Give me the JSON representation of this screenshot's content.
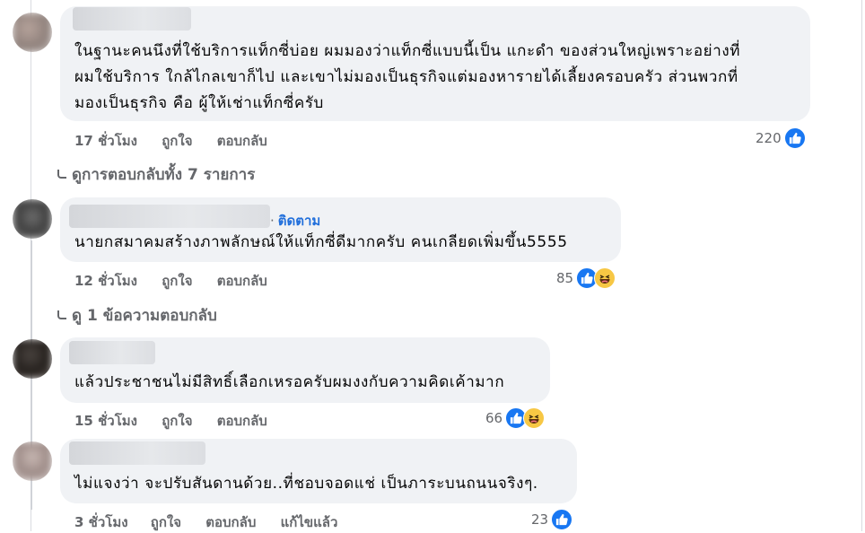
{
  "comments": [
    {
      "lines": [
        "ในฐานะคนนึงที่ใช้บริการแท็กซี่บ่อย ผมมองว่าแท็กซี่แบบนี้เป็น แกะดำ ของส่วนใหญ่เพราะอย่างที่",
        "ผมใช้บริการ ใกล้ไกลเขาก็ไป และเขาไม่มองเป็นธุรกิจแต่มองหารายได้เลี้ยงครอบครัว ส่วนพวกที่",
        "มองเป็นธุรกิจ คือ ผู้ให้เช่าแท็กซี่ครับ"
      ],
      "time": "17 ชั่วโมง",
      "like": "ถูกใจ",
      "reply": "ตอบกลับ",
      "count": "220"
    },
    {
      "follow": "ติดตาม",
      "text": "นายกสมาคมสร้างภาพลักษณ์ให้แท็กซี่ดีมากครับ คนเกลียดเพิ่มขึ้น5555",
      "time": "12 ชั่วโมง",
      "like": "ถูกใจ",
      "reply": "ตอบกลับ",
      "count": "85"
    },
    {
      "text": "แล้วประชาชนไม่มีสิทธิ์เลือกเหรอครับผมงงกับความคิดเค้ามาก",
      "time": "15 ชั่วโมง",
      "like": "ถูกใจ",
      "reply": "ตอบกลับ",
      "count": "66"
    },
    {
      "text": "ไม่แจงว่า จะปรับสันดานด้วย..ที่ชอบจอดแช่ เป็นภาระบนถนนจริงๆ.",
      "time": "3 ชั่วโมง",
      "like": "ถูกใจ",
      "reply": "ตอบกลับ",
      "edited": "แก้ไขแล้ว",
      "count": "23"
    }
  ],
  "view_replies": [
    "ดูการตอบกลับทั้ง 7 รายการ",
    "ดู 1 ข้อความตอบกลับ"
  ],
  "colors": {
    "like": "#1877f2",
    "link": "#216fdb",
    "meta": "#65676b",
    "bubble": "#f0f2f5"
  },
  "icons": [
    "like-icon",
    "haha-icon",
    "reply-arrow-icon"
  ]
}
